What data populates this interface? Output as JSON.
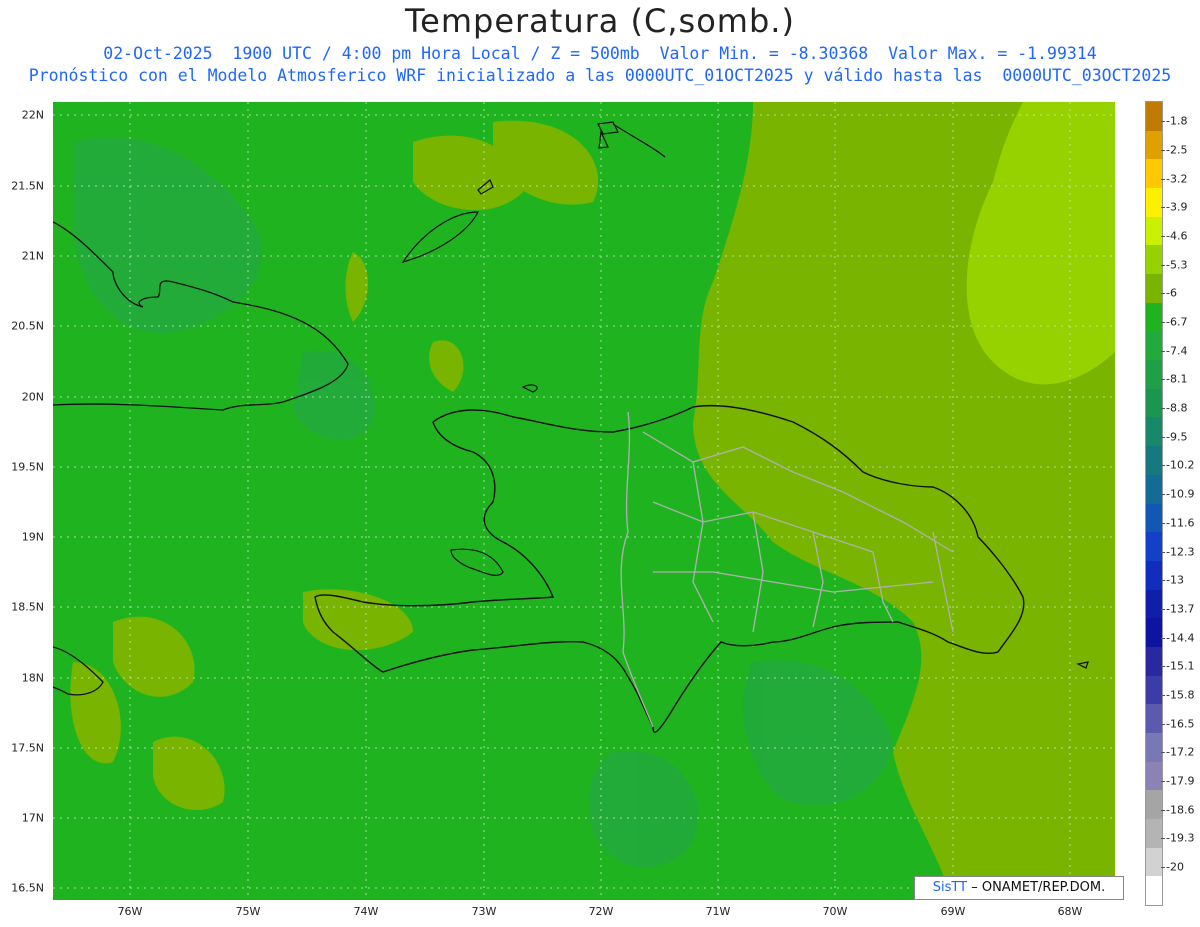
{
  "header": {
    "title": "Temperatura (C,somb.)",
    "line1": "02-Oct-2025  1900 UTC / 4:00 pm Hora Local / Z = 500mb  Valor Min. = -8.30368  Valor Max. = -1.99314",
    "line2": "Pronóstico con el Modelo Atmosferico WRF inicializado a las 0000UTC_01OCT2025 y válido hasta las  0000UTC_03OCT2025"
  },
  "axes": {
    "lat_labels": [
      "22N",
      "21.5N",
      "21N",
      "20.5N",
      "20N",
      "19.5N",
      "19N",
      "18.5N",
      "18N",
      "17.5N",
      "17N",
      "16.5N"
    ],
    "lon_labels": [
      "76W",
      "75W",
      "74W",
      "73W",
      "72W",
      "71W",
      "70W",
      "69W",
      "68W"
    ]
  },
  "colorbar": {
    "labels": [
      "-1.8",
      "-2.5",
      "-3.2",
      "-3.9",
      "-4.6",
      "-5.3",
      "-6",
      "-6.7",
      "-7.4",
      "-8.1",
      "-8.8",
      "-9.5",
      "-10.2",
      "-10.9",
      "-11.6",
      "-12.3",
      "-13",
      "-13.7",
      "-14.4",
      "-15.1",
      "-15.8",
      "-16.5",
      "-17.2",
      "-17.9",
      "-18.6",
      "-19.3",
      "-20"
    ],
    "colors": [
      "#c07a00",
      "#e0a000",
      "#ffc800",
      "#ffef00",
      "#c8f000",
      "#96d200",
      "#78b400",
      "#1fb41f",
      "#23aa3c",
      "#1fa046",
      "#1a9650",
      "#17896a",
      "#157a80",
      "#146b96",
      "#1357b4",
      "#1241c8",
      "#102dbe",
      "#0f1faa",
      "#0f14a0",
      "#2828a0",
      "#3c3ca8",
      "#5a5aaf",
      "#7878b4",
      "#8c82b4",
      "#a5a5a5",
      "#b4b4b4",
      "#d2d2d2",
      "#ffffff"
    ]
  },
  "map": {
    "region": "Hispaniola / Caribe",
    "base_color": "#1fb41f",
    "warm_color": "#78b400",
    "warmer_color": "#96d200",
    "cool_color": "#23aa3c"
  },
  "credit": {
    "logo": "SisTT",
    "text": "– ONAMET/REP.DOM."
  }
}
